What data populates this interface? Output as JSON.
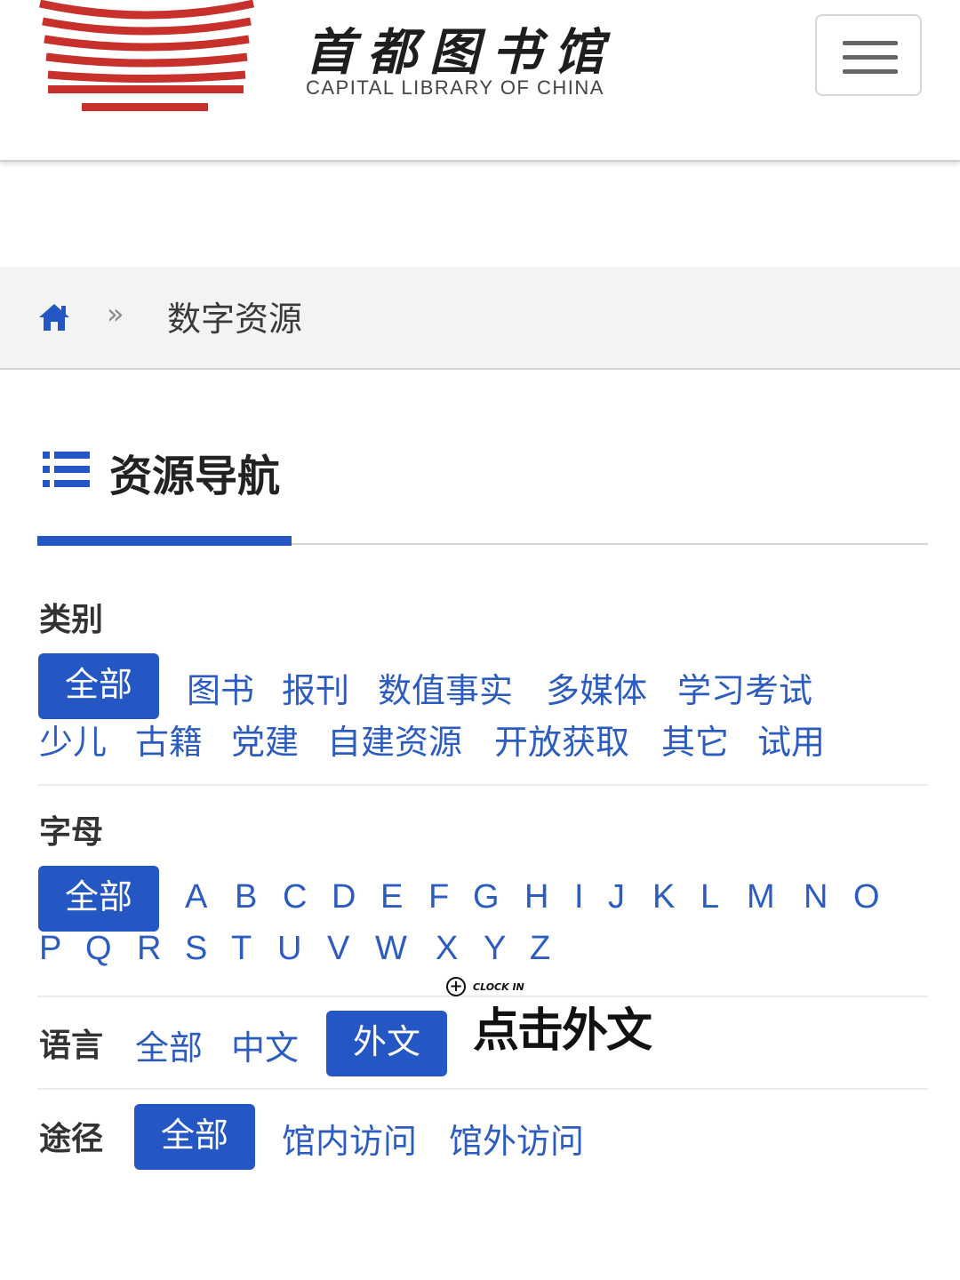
{
  "header": {
    "logo_cn": "首都图书馆",
    "logo_en": "CAPITAL LIBRARY OF CHINA",
    "menu_icon": "hamburger-menu-icon",
    "logo_color": "#c8302b"
  },
  "breadcrumb": {
    "home_icon": "home-icon",
    "separator": "»",
    "current": "数字资源"
  },
  "section": {
    "icon": "list-icon",
    "title": "资源导航",
    "accent_color": "#2456c4"
  },
  "filters": {
    "category": {
      "label": "类别",
      "options": [
        "全部",
        "图书",
        "报刊",
        "数值事实",
        "多媒体",
        "学习考试",
        "少儿",
        "古籍",
        "党建",
        "自建资源",
        "开放获取",
        "其它",
        "试用"
      ],
      "selected": "全部"
    },
    "letter": {
      "label": "字母",
      "all": "全部",
      "letters": [
        "A",
        "B",
        "C",
        "D",
        "E",
        "F",
        "G",
        "H",
        "I",
        "J",
        "K",
        "L",
        "M",
        "N",
        "O",
        "P",
        "Q",
        "R",
        "S",
        "T",
        "U",
        "V",
        "W",
        "X",
        "Y",
        "Z"
      ],
      "selected": "全部"
    },
    "language": {
      "label": "语言",
      "options": [
        "全部",
        "中文",
        "外文"
      ],
      "selected": "外文"
    },
    "access": {
      "label": "途径",
      "options": [
        "全部",
        "馆内访问",
        "馆外访问"
      ],
      "selected": "全部"
    }
  },
  "annotation": {
    "small": "CLOCK IN",
    "big": "点击外文"
  }
}
